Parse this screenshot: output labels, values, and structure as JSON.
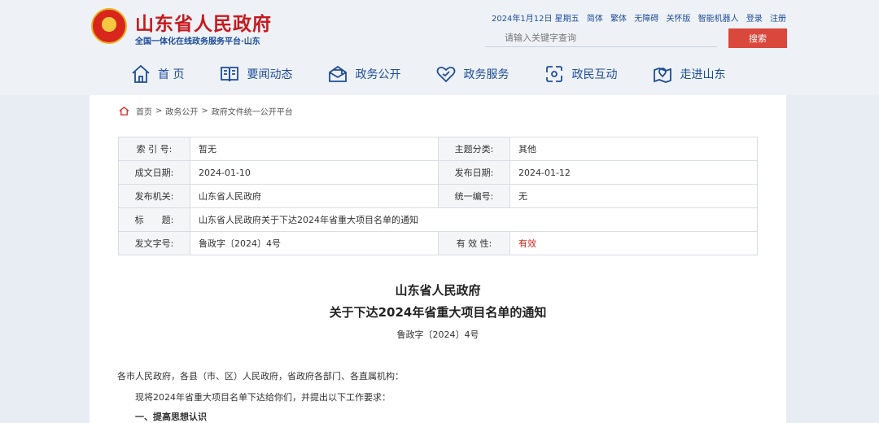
{
  "header": {
    "site_title": "山东省人民政府",
    "site_subtitle": "全国一体化在线政务服务平台·山东",
    "top_links": {
      "date": "2024年1月12日 星期五",
      "simplified": "简体",
      "traditional": "繁体",
      "accessibility": "无障碍",
      "elder_mode": "关怀版",
      "robot": "智能机器人",
      "login": "登录",
      "register": "注册"
    },
    "search": {
      "placeholder": "请输入关键字查询",
      "button": "搜索"
    },
    "nav": [
      {
        "label": "首 页",
        "icon": "home-icon"
      },
      {
        "label": "要闻动态",
        "icon": "news-icon"
      },
      {
        "label": "政务公开",
        "icon": "disclosure-icon"
      },
      {
        "label": "政务服务",
        "icon": "service-icon"
      },
      {
        "label": "政民互动",
        "icon": "interaction-icon"
      },
      {
        "label": "走进山东",
        "icon": "location-icon"
      }
    ]
  },
  "breadcrumb": [
    "首页",
    "政务公开",
    "政府文件统一公开平台"
  ],
  "meta": {
    "index_label": "索 引 号:",
    "index_value": "暂无",
    "topic_label": "主题分类:",
    "topic_value": "其他",
    "written_label": "成文日期:",
    "written_value": "2024-01-10",
    "published_label": "发布日期:",
    "published_value": "2024-01-12",
    "issuer_label": "发布机关:",
    "issuer_value": "山东省人民政府",
    "serial_label": "统一编号:",
    "serial_value": "无",
    "title_label": "标　　题:",
    "title_value": "山东省人民政府关于下达2024年省重大项目名单的通知",
    "doc_no_label": "发文字号:",
    "doc_no_value": "鲁政字〔2024〕4号",
    "validity_label": "有 效 性:",
    "validity_value": "有效"
  },
  "document": {
    "title_line1": "山东省人民政府",
    "title_line2": "关于下达2024年省重大项目名单的通知",
    "doc_number": "鲁政字〔2024〕4号",
    "addressee": "各市人民政府，各县（市、区）人民政府，省政府各部门、各直属机构：",
    "intro": "现将2024年省重大项目名单下达给你们，并提出以下工作要求：",
    "section1": "一、提高思想认识"
  },
  "colors": {
    "brand_red": "#c7191c",
    "nav_blue": "#1e4c9c",
    "search_button": "#d9473d",
    "valid_red": "#d0251e"
  }
}
